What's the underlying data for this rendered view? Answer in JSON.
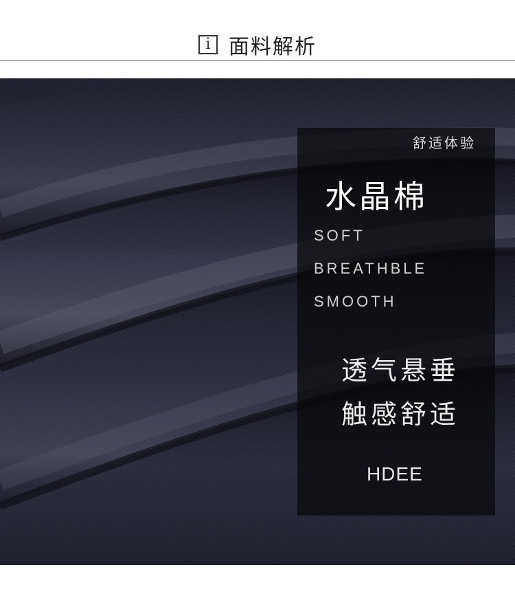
{
  "header": {
    "icon": "info-icon",
    "icon_glyph": "i",
    "title": "面料解析"
  },
  "fabric_image": {
    "colors": {
      "base": "#1d1f2e",
      "highlight": "#4a4c5c",
      "shadow": "#0e0f18"
    }
  },
  "panel": {
    "subtitle": "舒适体验",
    "title": "水晶棉",
    "features": [
      "SOFT",
      "BREATHBLE",
      "SMOOTH"
    ],
    "cn_lines": [
      "透气悬垂",
      "触感舒适"
    ],
    "brand": "HDEE"
  }
}
